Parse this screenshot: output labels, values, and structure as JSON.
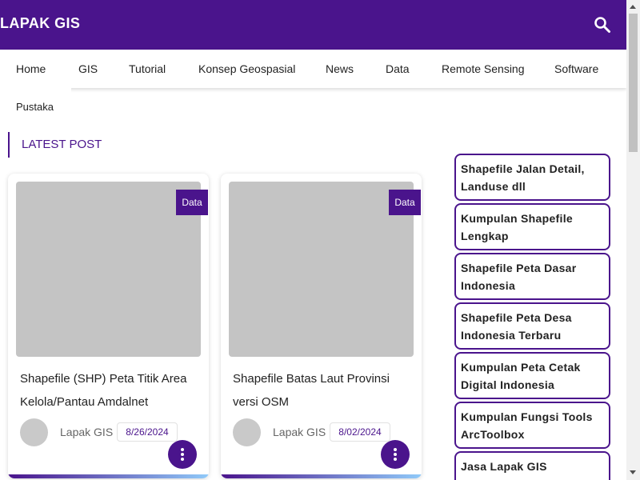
{
  "header": {
    "brand": "LAPAK GIS",
    "search_icon": "search-icon",
    "background": "#4a148c"
  },
  "nav": {
    "items": [
      {
        "label": "Home"
      },
      {
        "label": "GIS"
      },
      {
        "label": "Tutorial"
      },
      {
        "label": "Konsep Geospasial"
      },
      {
        "label": "News"
      },
      {
        "label": "Data"
      },
      {
        "label": "Remote Sensing"
      },
      {
        "label": "Software"
      },
      {
        "label": "Pustaka"
      }
    ]
  },
  "section": {
    "title": "LATEST POST"
  },
  "posts": [
    {
      "category": "Data",
      "title": "Shapefile (SHP) Peta Titik Area Kelola/Pantau Amdalnet",
      "author": "Lapak GIS",
      "date": "8/26/2024"
    },
    {
      "category": "Data",
      "title": "Shapefile Batas Laut Provinsi versi OSM",
      "author": "Lapak GIS",
      "date": "8/02/2024"
    }
  ],
  "sidebar": {
    "items": [
      {
        "label": "Shapefile Jalan Detail, Landuse dll"
      },
      {
        "label": "Kumpulan Shapefile Lengkap"
      },
      {
        "label": "Shapefile Peta Dasar Indonesia"
      },
      {
        "label": "Shapefile Peta Desa Indonesia Terbaru"
      },
      {
        "label": "Kumpulan Peta Cetak Digital Indonesia"
      },
      {
        "label": "Kumpulan Fungsi Tools ArcToolbox"
      },
      {
        "label": "Jasa Lapak GIS"
      }
    ]
  },
  "colors": {
    "accent": "#4a148c",
    "thumbnail_placeholder": "#c4c4c4"
  }
}
